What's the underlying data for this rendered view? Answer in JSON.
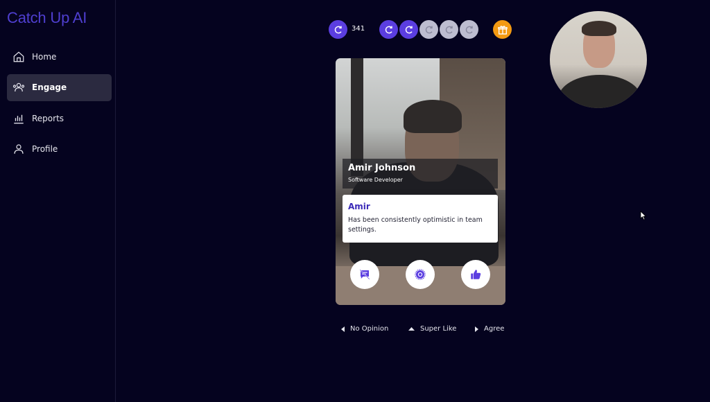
{
  "brand": {
    "title": "Catch Up AI"
  },
  "sidebar": {
    "items": [
      {
        "label": "Home",
        "icon": "home-icon",
        "active": false
      },
      {
        "label": "Engage",
        "icon": "engage-icon",
        "active": true
      },
      {
        "label": "Reports",
        "icon": "reports-icon",
        "active": false
      },
      {
        "label": "Profile",
        "icon": "profile-icon",
        "active": false
      }
    ]
  },
  "tokens": {
    "count": "341",
    "slots": [
      {
        "state": "filled"
      },
      {
        "state": "filled"
      },
      {
        "state": "empty"
      },
      {
        "state": "empty"
      },
      {
        "state": "empty"
      }
    ],
    "icon": "refresh-coin-icon",
    "gift_icon": "gift-icon"
  },
  "card": {
    "name": "Amir Johnson",
    "role": "Software Developer",
    "comment": {
      "author": "Amir",
      "text": "Has been consistently optimistic in team settings."
    },
    "actions": [
      {
        "name": "no-opinion-button",
        "icon": "no-comment-icon"
      },
      {
        "name": "super-like-button",
        "icon": "badge-icon"
      },
      {
        "name": "agree-button",
        "icon": "thumbs-up-icon"
      }
    ]
  },
  "legend": {
    "left": "No Opinion",
    "up": "Super Like",
    "right": "Agree"
  },
  "colors": {
    "background": "#05031f",
    "accent": "#5b3ee0",
    "brand": "#4f3fd0",
    "gift": "#f39a12",
    "active_nav": "#2b2a40"
  }
}
